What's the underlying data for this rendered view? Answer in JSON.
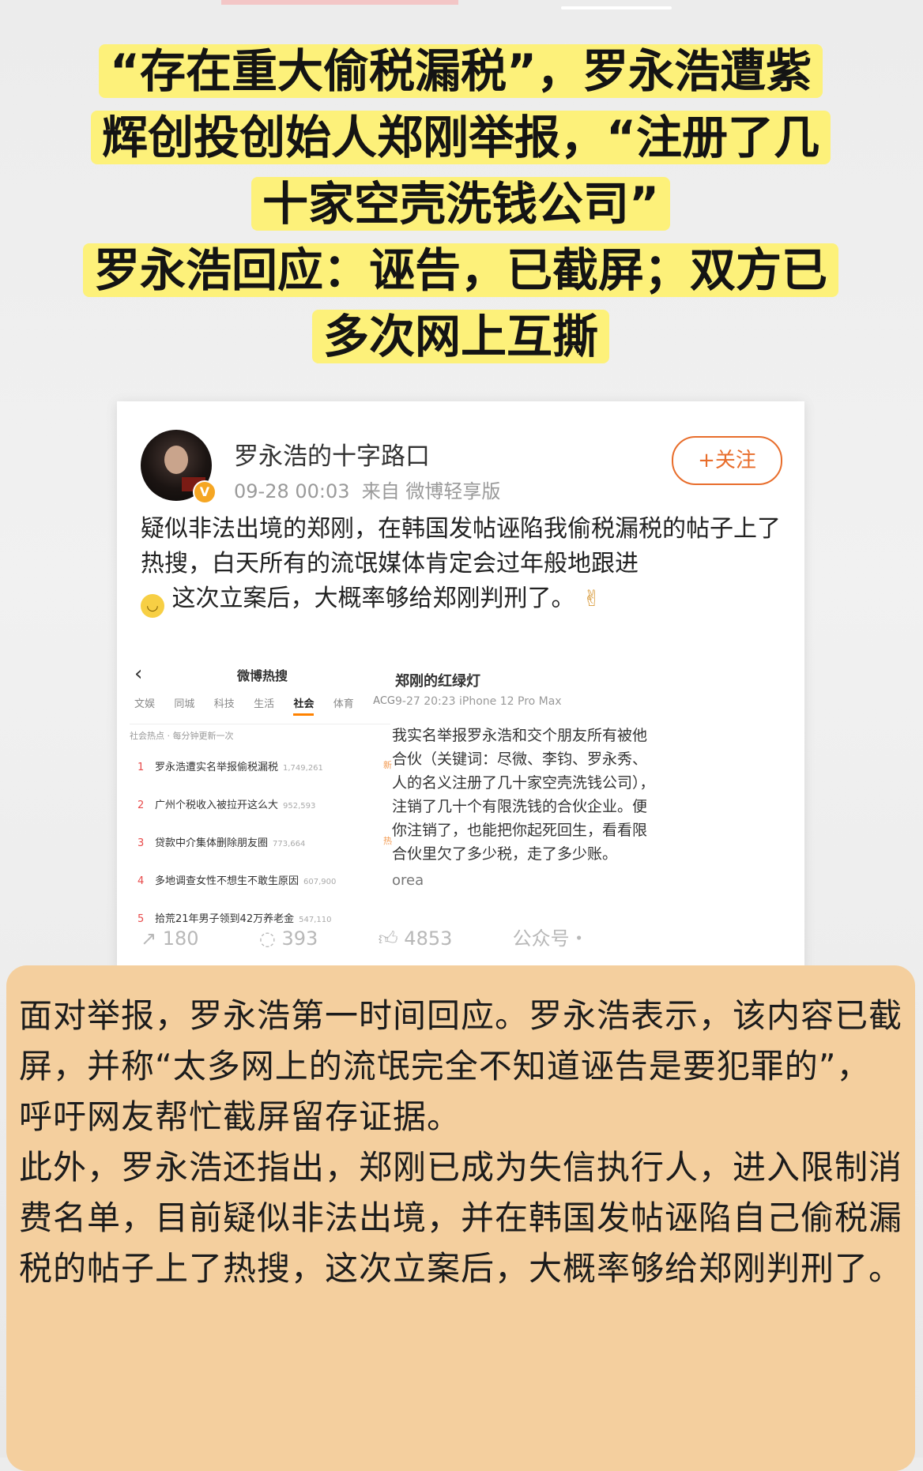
{
  "headline": {
    "line1": "“存在重大偷税漏税”，罗永浩遭紫",
    "line2": "辉创投创始人郑刚举报，“注册了几",
    "line3": "十家空壳洗钱公司”",
    "line4": "罗永浩回应：诬告，已截屏；双方已",
    "line5": "多次网上互撕"
  },
  "post": {
    "author": "罗永浩的十字路口",
    "time": "09-28 00:03",
    "source": "来自 微博轻享版",
    "follow_label": "+关注",
    "text1": "疑似非法出境的郑刚，在韩国发帖诬陷我偷税漏税的帖子上了热搜，白天所有的流氓媒体肯定会过年般地跟进",
    "text2": "这次立案后，大概率够给郑刚判刑了。",
    "emoji_icon": "slight-smile-icon",
    "victory_icon": "victory-hand-icon",
    "actions": {
      "reposts": "180",
      "comments": "393",
      "likes": "4853",
      "watermark": "公众号・"
    }
  },
  "hot_search": {
    "title": "微博热搜",
    "tabs": [
      "文娱",
      "同城",
      "科技",
      "生活",
      "社会",
      "体育",
      "ACG"
    ],
    "active_tab": "社会",
    "subtitle": "社会热点 · 每分钟更新一次",
    "items": [
      {
        "rank": "1",
        "text": "罗永浩遭实名举报偷税漏税",
        "count": "1,749,261",
        "hot": "新"
      },
      {
        "rank": "2",
        "text": "广州个税收入被拉开这么大",
        "count": "952,593",
        "hot": ""
      },
      {
        "rank": "3",
        "text": "贷款中介集体删除朋友圈",
        "count": "773,664",
        "hot": "热"
      },
      {
        "rank": "4",
        "text": "多地调查女性不想生不敢生原因",
        "count": "607,900",
        "hot": ""
      },
      {
        "rank": "5",
        "text": "拾荒21年男子领到42万养老金",
        "count": "547,110",
        "hot": ""
      }
    ]
  },
  "repost": {
    "name": "郑刚的红绿灯",
    "meta": "9-27 20:23  iPhone 12 Pro Max",
    "text": "我实名举报罗永浩和交个朋友所有被他合伙（关键词：尽微、李钧、罗永秀、人的名义注册了几十家空壳洗钱公司），注销了几十个有限洗钱的合伙企业。便你注销了，也能把你起死回生，看看限合伙里欠了多少税，走了多少账。",
    "footer": "orea"
  },
  "commentary": {
    "para1": "面对举报，罗永浩第一时间回应。罗永浩表示，该内容已截屏，并称“太多网上的流氓完全不知道诬告是要犯罪的”，呼吁网友帮忙截屏留存证据。",
    "para2": "此外，罗永浩还指出，郑刚已成为失信执行人，进入限制消费名单，目前疑似非法出境，并在韩国发帖诬陷自己偷税漏税的帖子上了热搜，这次立案后，大概率够给郑刚判刑了。"
  }
}
